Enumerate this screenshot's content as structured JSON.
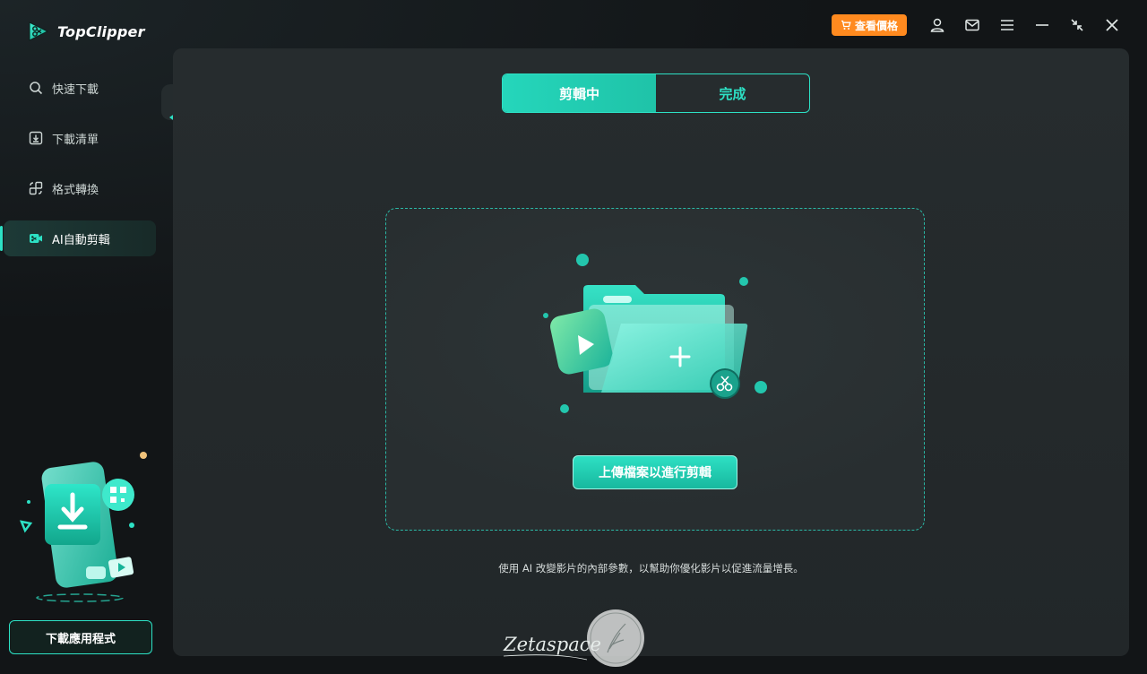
{
  "app": {
    "name": "TopClipper"
  },
  "topbar": {
    "pricing_label": "查看價格",
    "icons": [
      "user-icon",
      "mail-icon",
      "menu-icon",
      "minimize-icon",
      "restore-icon",
      "close-icon"
    ]
  },
  "sidebar": {
    "items": [
      {
        "label": "快速下載",
        "icon": "search-icon",
        "active": false
      },
      {
        "label": "下載清單",
        "icon": "download-list-icon",
        "active": false
      },
      {
        "label": "格式轉換",
        "icon": "convert-icon",
        "active": false
      },
      {
        "label": "AI自動剪輯",
        "icon": "ai-clip-icon",
        "active": true
      }
    ],
    "download_app_label": "下載應用程式"
  },
  "main": {
    "tabs": [
      {
        "label": "剪輯中",
        "active": true
      },
      {
        "label": "完成",
        "active": false
      }
    ],
    "upload_label": "上傳檔案以進行剪輯",
    "hint": "使用 AI 改變影片的內部參數，以幫助你優化影片以促進流量增長。"
  },
  "watermark": {
    "text": "Zetaspace"
  },
  "colors": {
    "accent": "#2de1c5",
    "pricing": "#ff8a1f",
    "panel": "#262c2e",
    "background": "#161a1c"
  }
}
